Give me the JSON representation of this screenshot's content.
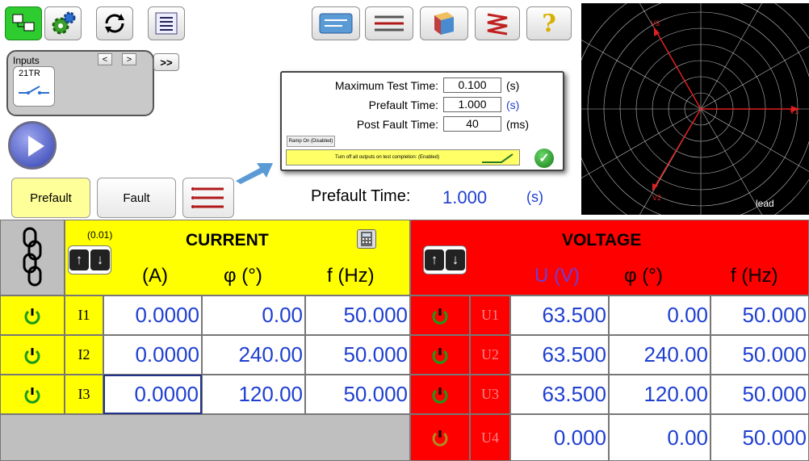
{
  "toolbar": {
    "left_icons": [
      "module-icon",
      "settings-icon",
      "refresh-icon",
      "report-icon"
    ],
    "right_icons": [
      "test-view-icon",
      "sequence-icon",
      "document-icon",
      "ramp-icon",
      "help-icon"
    ],
    "help_label": "?"
  },
  "inputs": {
    "label": "Inputs",
    "prev": "<",
    "next": ">",
    "more": ">>",
    "item": "21TR"
  },
  "mode_buttons": {
    "prefault": "Prefault",
    "fault": "Fault"
  },
  "popup": {
    "max_test_time_label": "Maximum Test Time:",
    "max_test_time_value": "0.100",
    "max_test_time_unit": "(s)",
    "prefault_time_label": "Prefault Time:",
    "prefault_time_value": "1.000",
    "prefault_time_unit": "(s)",
    "post_fault_label": "Post Fault Time:",
    "post_fault_value": "40",
    "post_fault_unit": "(ms)",
    "ramp_label": "Ramp On (Disabled)",
    "turnoff_label": "Turn off all outputs on test completion: (Enabled)"
  },
  "prefault_display": {
    "label": "Prefault Time:",
    "value": "1.000",
    "unit": "(s)"
  },
  "vector": {
    "labels": [
      "V3",
      "V1",
      "V2"
    ],
    "lead": "lead"
  },
  "current": {
    "step": "(0.01)",
    "title": "CURRENT",
    "cols": [
      "(A)",
      "φ  (°)",
      "f  (Hz)"
    ],
    "rows": [
      {
        "label": "I1",
        "amp": "0.0000",
        "phase": "0.00",
        "freq": "50.000"
      },
      {
        "label": "I2",
        "amp": "0.0000",
        "phase": "240.00",
        "freq": "50.000"
      },
      {
        "label": "I3",
        "amp": "0.0000",
        "phase": "120.00",
        "freq": "50.000"
      }
    ]
  },
  "voltage": {
    "title": "VOLTAGE",
    "cols": [
      "U (V)",
      "φ  (°)",
      "f  (Hz)"
    ],
    "rows": [
      {
        "label": "U1",
        "amp": "63.500",
        "phase": "0.00",
        "freq": "50.000"
      },
      {
        "label": "U2",
        "amp": "63.500",
        "phase": "240.00",
        "freq": "50.000"
      },
      {
        "label": "U3",
        "amp": "63.500",
        "phase": "120.00",
        "freq": "50.000"
      },
      {
        "label": "U4",
        "amp": "0.000",
        "phase": "0.00",
        "freq": "50.000"
      }
    ]
  },
  "colors": {
    "current_header": "#ffff00",
    "voltage_header": "#ff0000",
    "value_blue": "#1f3fd0"
  }
}
